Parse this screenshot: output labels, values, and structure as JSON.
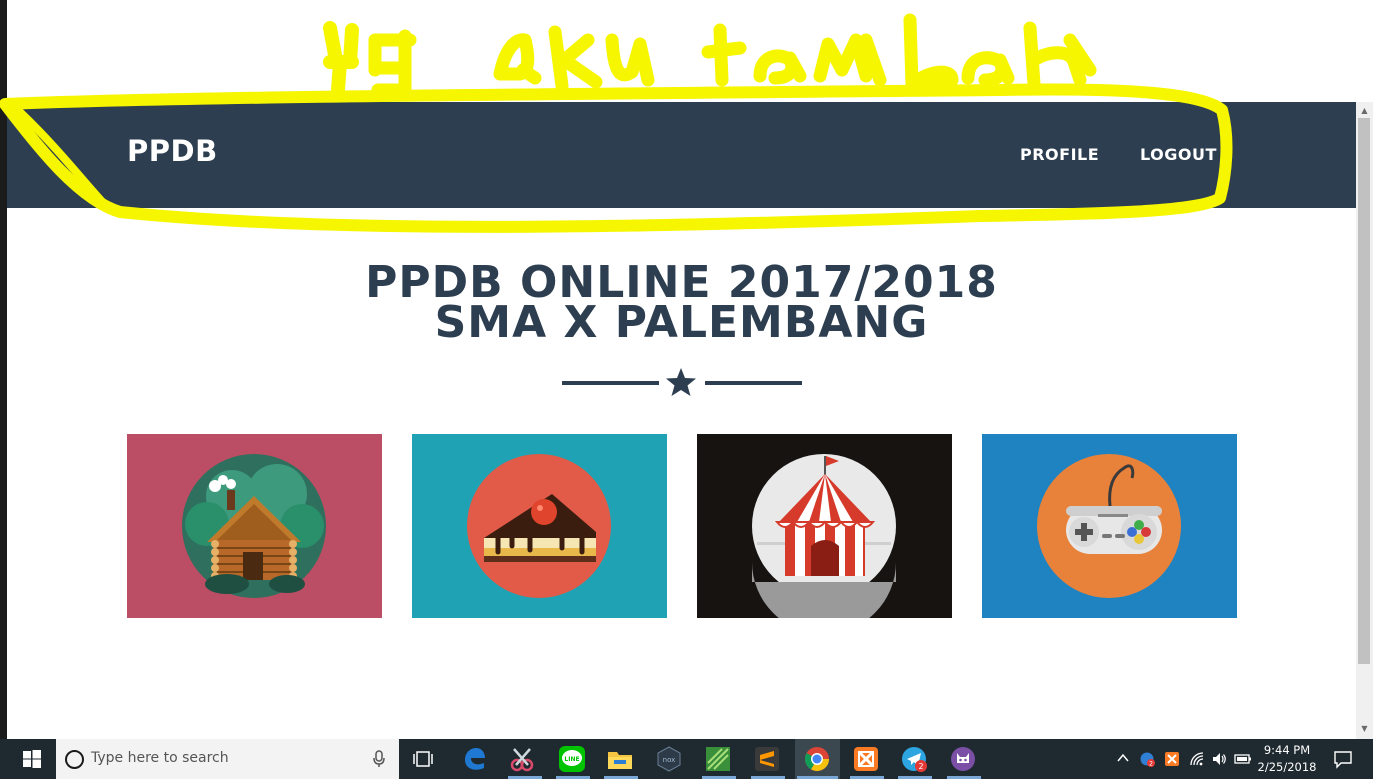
{
  "annotation": {
    "handwritten_text": "yg aku tambah",
    "color": "#f6f600"
  },
  "navbar": {
    "brand": "PPDB",
    "links": [
      {
        "label": "PROFILE"
      },
      {
        "label": "LOGOUT"
      }
    ],
    "bg": "#2c3e50"
  },
  "hero": {
    "title_line1": "PPDB ONLINE 2017/2018",
    "title_line2": "SMA X PALEMBANG",
    "divider_icon": "star-icon",
    "color": "#2c3e50"
  },
  "portfolio": [
    {
      "icon": "cabin-icon",
      "bg": "#bb4d64"
    },
    {
      "icon": "cake-icon",
      "bg": "#1fa3b4"
    },
    {
      "icon": "circus-tent-icon",
      "bg": "#171311"
    },
    {
      "icon": "game-controller-icon",
      "bg": "#1f82c1"
    }
  ],
  "taskbar": {
    "search_placeholder": "Type here to search",
    "apps": [
      "edge-icon",
      "snipping-tool-icon",
      "line-icon",
      "file-explorer-icon",
      "nox-icon",
      "excel-like-icon",
      "sublime-text-icon",
      "chrome-icon",
      "xampp-icon",
      "telegram-icon",
      "cat-app-icon"
    ],
    "telegram_badge": "2",
    "tray_badge": "2",
    "time": "9:44 PM",
    "date": "2/25/2018"
  }
}
